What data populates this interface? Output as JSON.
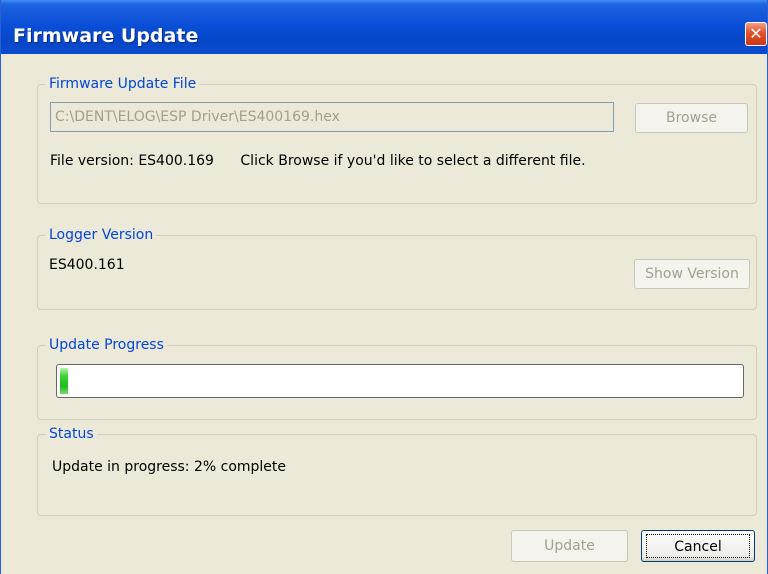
{
  "window": {
    "title": "Firmware Update",
    "close_glyph": "✕"
  },
  "file_group": {
    "legend": "Firmware Update File",
    "path_value": "C:\\DENT\\ELOG\\ESP Driver\\ES400169.hex",
    "browse_label": "Browse",
    "file_version_text": "File version: ES400.169",
    "hint_text": "Click Browse if you'd like to select a different file."
  },
  "logger_group": {
    "legend": "Logger Version",
    "version_text": "ES400.161",
    "show_version_label": "Show Version"
  },
  "progress_group": {
    "legend": "Update Progress",
    "percent": 2,
    "fill_color": "#22b81f"
  },
  "status_group": {
    "legend": "Status",
    "status_text": "Update in progress: 2% complete"
  },
  "buttons": {
    "update_label": "Update",
    "cancel_label": "Cancel"
  },
  "colors": {
    "titlebar": "#0a4fd8",
    "legend_text": "#0046d5",
    "window_bg": "#ece9d8",
    "close_button": "#e0512a"
  }
}
